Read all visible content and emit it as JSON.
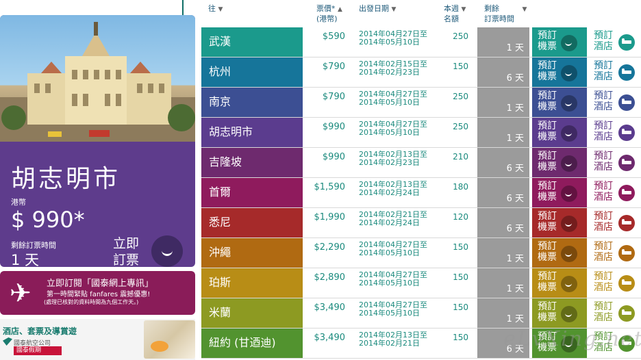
{
  "featured": {
    "city": "胡志明市",
    "currency": "港幣",
    "price": "$ 990*",
    "remaining_label": "剩餘訂票時間",
    "remaining": "1 天",
    "book_label": "立即訂票"
  },
  "promo": {
    "line1": "立即訂閱「國泰網上專訊」",
    "line2": "第一時間緊貼 fanfares 震撼優惠!",
    "line3": "(處理已核對的資料時間為九個工作天。)"
  },
  "hotel_banner": {
    "title": "酒店、套票及導賞遊",
    "brand": "國泰航空公司",
    "sub": "國泰假期"
  },
  "headers": {
    "dest": "往",
    "price": "票價*",
    "price_unit": "(港幣)",
    "date": "出發日期",
    "seats": "本週",
    "seats2": "名額",
    "remaining": "剩餘",
    "remaining2": "訂票時間"
  },
  "book_label": "預訂機票",
  "hotel_label": "預訂酒店",
  "rows": [
    {
      "city": "武漢",
      "price": "$590",
      "date1": "2014年04月27日至",
      "date2": "2014年05月10日",
      "seats": "250",
      "remaining": "1 天",
      "color": "#1b9a8c"
    },
    {
      "city": "杭州",
      "price": "$790",
      "date1": "2014年02月15日至",
      "date2": "2014年02月23日",
      "seats": "150",
      "remaining": "6 天",
      "color": "#16759a"
    },
    {
      "city": "南京",
      "price": "$790",
      "date1": "2014年04月27日至",
      "date2": "2014年05月10日",
      "seats": "250",
      "remaining": "1 天",
      "color": "#3c4f93"
    },
    {
      "city": "胡志明市",
      "price": "$990",
      "date1": "2014年04月27日至",
      "date2": "2014年05月10日",
      "seats": "250",
      "remaining": "1 天",
      "color": "#5b3c8e"
    },
    {
      "city": "吉隆坡",
      "price": "$990",
      "date1": "2014年02月13日至",
      "date2": "2014年02月23日",
      "seats": "210",
      "remaining": "6 天",
      "color": "#6e2a6e"
    },
    {
      "city": "首爾",
      "price": "$1,590",
      "date1": "2014年02月13日至",
      "date2": "2014年02月24日",
      "seats": "180",
      "remaining": "6 天",
      "color": "#8f1b5d"
    },
    {
      "city": "悉尼",
      "price": "$1,990",
      "date1": "2014年02月21日至",
      "date2": "2014年02月24日",
      "seats": "120",
      "remaining": "6 天",
      "color": "#a62a2a"
    },
    {
      "city": "沖繩",
      "price": "$2,290",
      "date1": "2014年04月27日至",
      "date2": "2014年05月10日",
      "seats": "150",
      "remaining": "1 天",
      "color": "#b06a12"
    },
    {
      "city": "珀斯",
      "price": "$2,890",
      "date1": "2014年04月27日至",
      "date2": "2014年05月10日",
      "seats": "150",
      "remaining": "1 天",
      "color": "#b88d16"
    },
    {
      "city": "米蘭",
      "price": "$3,490",
      "date1": "2014年04月27日至",
      "date2": "2014年05月10日",
      "seats": "150",
      "remaining": "1 天",
      "color": "#8d9a22"
    },
    {
      "city": "紐約 (甘迺迪)",
      "price": "$3,490",
      "date1": "2014年02月13日至",
      "date2": "2014年02月21日",
      "seats": "150",
      "remaining": "6 天",
      "color": "#52932f"
    }
  ],
  "watermark": "eLvXing.net"
}
